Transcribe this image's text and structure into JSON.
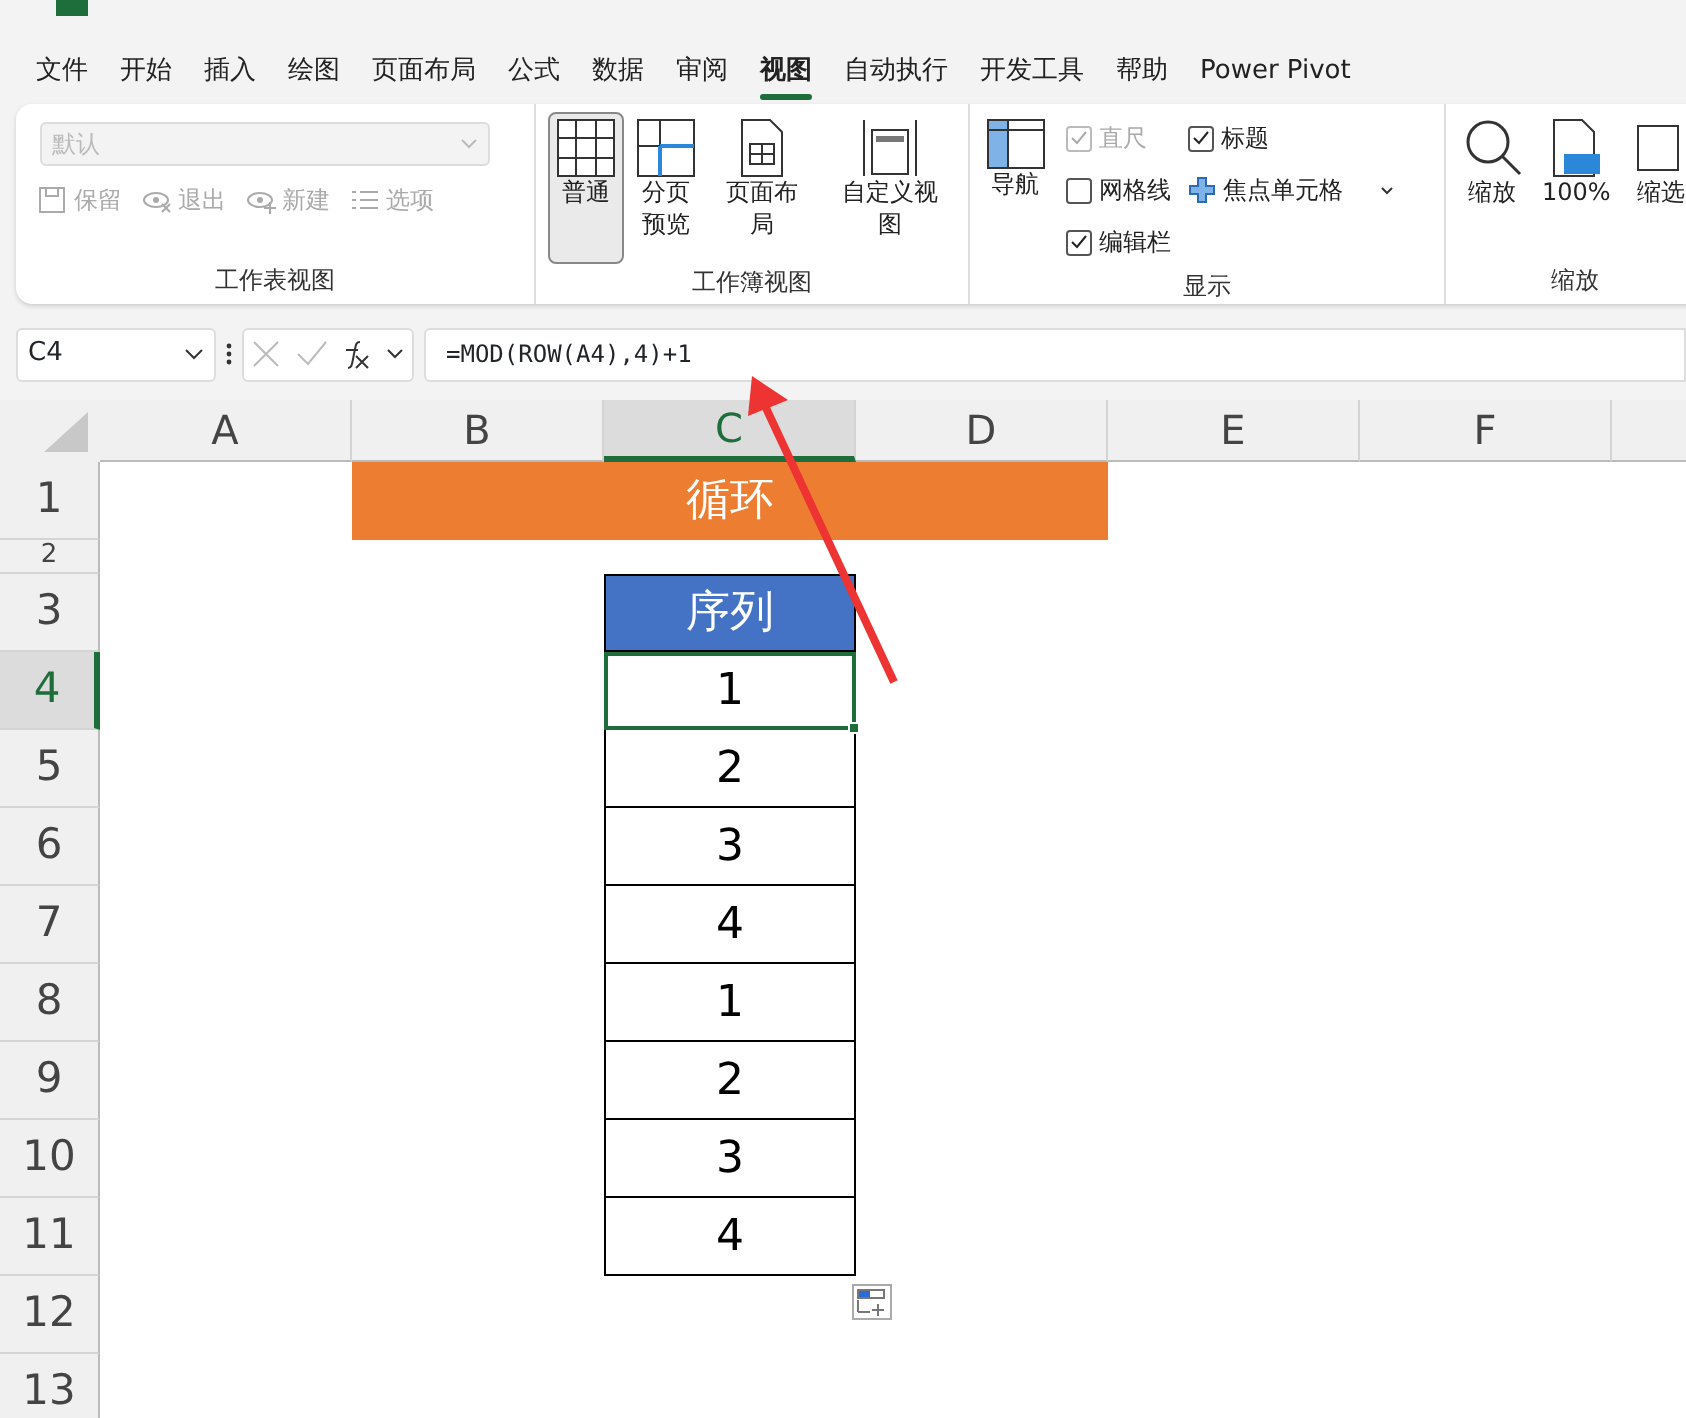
{
  "menu_tabs": [
    {
      "label": "文件",
      "selected": false
    },
    {
      "label": "开始",
      "selected": false
    },
    {
      "label": "插入",
      "selected": false
    },
    {
      "label": "绘图",
      "selected": false
    },
    {
      "label": "页面布局",
      "selected": false
    },
    {
      "label": "公式",
      "selected": false
    },
    {
      "label": "数据",
      "selected": false
    },
    {
      "label": "审阅",
      "selected": false
    },
    {
      "label": "视图",
      "selected": true
    },
    {
      "label": "自动执行",
      "selected": false
    },
    {
      "label": "开发工具",
      "selected": false
    },
    {
      "label": "帮助",
      "selected": false
    },
    {
      "label": "Power Pivot",
      "selected": false
    }
  ],
  "ribbon": {
    "sheet_view": {
      "label": "工作表视图",
      "dropdown": {
        "placeholder": "默认",
        "disabled": true
      },
      "buttons": [
        {
          "label": "保留",
          "kind": "save",
          "disabled": true
        },
        {
          "label": "退出",
          "kind": "exit",
          "disabled": true
        },
        {
          "label": "新建",
          "kind": "new",
          "disabled": true
        },
        {
          "label": "选项",
          "kind": "options",
          "disabled": true
        }
      ]
    },
    "workbook_views": {
      "label": "工作簿视图",
      "buttons": [
        {
          "label": "普通",
          "kind": "normal",
          "selected": true
        },
        {
          "label": "分页预览",
          "kind": "pagebreak",
          "selected": false
        },
        {
          "label": "页面布局",
          "kind": "layout",
          "selected": false
        },
        {
          "label": "自定义视图",
          "kind": "custom",
          "selected": false
        }
      ]
    },
    "show": {
      "label": "显示",
      "navigation": "导航",
      "checkboxes": [
        {
          "label": "直尺",
          "checked": true,
          "disabled": true
        },
        {
          "label": "网格线",
          "checked": false,
          "disabled": false
        },
        {
          "label": "编辑栏",
          "checked": true,
          "disabled": false
        },
        {
          "label": "标题",
          "checked": true,
          "disabled": false
        }
      ],
      "focus_cell": "焦点单元格"
    },
    "zoom": {
      "label": "缩放",
      "buttons": [
        {
          "label": "缩放",
          "kind": "zoom"
        },
        {
          "label": "100%",
          "kind": "hundred"
        },
        {
          "label": "缩选",
          "kind": "selection"
        }
      ]
    }
  },
  "formula_bar": {
    "name_box": "C4",
    "formula": "=MOD(ROW(A4),4)+1"
  },
  "columns": [
    {
      "label": "A",
      "selected": false
    },
    {
      "label": "B",
      "selected": false
    },
    {
      "label": "C",
      "selected": true
    },
    {
      "label": "D",
      "selected": false
    },
    {
      "label": "E",
      "selected": false
    },
    {
      "label": "F",
      "selected": false
    }
  ],
  "rows": [
    {
      "label": "1",
      "selected": false
    },
    {
      "label": "2",
      "selected": false
    },
    {
      "label": "3",
      "selected": false
    },
    {
      "label": "4",
      "selected": true
    },
    {
      "label": "5",
      "selected": false
    },
    {
      "label": "6",
      "selected": false
    },
    {
      "label": "7",
      "selected": false
    },
    {
      "label": "8",
      "selected": false
    },
    {
      "label": "9",
      "selected": false
    },
    {
      "label": "10",
      "selected": false
    },
    {
      "label": "11",
      "selected": false
    },
    {
      "label": "12",
      "selected": false
    },
    {
      "label": "13",
      "selected": false
    }
  ],
  "title_cell": "循环",
  "sequence": {
    "header": "序列",
    "values": [
      {
        "value": "1",
        "selected": true
      },
      {
        "value": "2",
        "selected": false
      },
      {
        "value": "3",
        "selected": false
      },
      {
        "value": "4",
        "selected": false
      },
      {
        "value": "1",
        "selected": false
      },
      {
        "value": "2",
        "selected": false
      },
      {
        "value": "3",
        "selected": false
      },
      {
        "value": "4",
        "selected": false
      }
    ]
  }
}
